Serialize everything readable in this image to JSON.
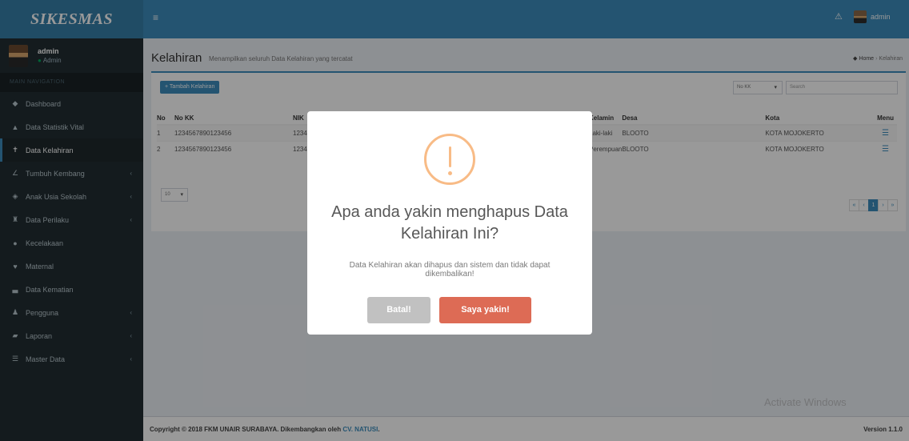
{
  "app": {
    "brand": "SIKESMAS",
    "menu_icon": "bars-icon",
    "bell_icon": "bell-icon",
    "username": "admin"
  },
  "sidebar": {
    "user_name": "admin",
    "user_status": "Admin",
    "header": "MAIN NAVIGATION",
    "items": [
      {
        "label": "Dashboard",
        "icon": "dashboard-icon",
        "glyph": "◆"
      },
      {
        "label": "Data Statistik Vital",
        "icon": "user-icon",
        "glyph": "▲"
      },
      {
        "label": "Data Kelahiran",
        "icon": "child-icon",
        "glyph": "✝"
      },
      {
        "label": "Tumbuh Kembang",
        "icon": "line-chart-icon",
        "glyph": "∠"
      },
      {
        "label": "Anak Usia Sekolah",
        "icon": "graduation-cap-icon",
        "glyph": "◈"
      },
      {
        "label": "Data Perilaku",
        "icon": "binoculars-icon",
        "glyph": "♜"
      },
      {
        "label": "Kecelakaan",
        "icon": "exclamation-circle-icon",
        "glyph": "●"
      },
      {
        "label": "Maternal",
        "icon": "heart-icon",
        "glyph": "♥"
      },
      {
        "label": "Data Kematian",
        "icon": "bed-icon",
        "glyph": "▃"
      },
      {
        "label": "Pengguna",
        "icon": "users-icon",
        "glyph": "♟"
      },
      {
        "label": "Laporan",
        "icon": "book-icon",
        "glyph": "▰"
      },
      {
        "label": "Master Data",
        "icon": "list-icon",
        "glyph": "☰"
      }
    ]
  },
  "header": {
    "title": "Kelahiran",
    "subtitle": "Menampilkan seluruh Data Kelahiran yang tercatat",
    "crumb_home": "Home",
    "crumb_current": "Kelahiran"
  },
  "toolbar": {
    "add_label": "Tambah Kelahiran",
    "filter_value": "No KK",
    "search_placeholder": "Search",
    "length_value": "10"
  },
  "table": {
    "columns": [
      "No",
      "No KK",
      "NIK",
      "Kelamin",
      "Desa",
      "Kota",
      "Menu"
    ],
    "rows": [
      {
        "no": "1",
        "kk": "1234567890123456",
        "nik": "1234567",
        "kelamin": "Laki-laki",
        "desa": "BLOOTO",
        "kota": "KOTA MOJOKERTO"
      },
      {
        "no": "2",
        "kk": "1234567890123456",
        "nik": "1234567",
        "kelamin": "Perempuan",
        "desa": "BLOOTO",
        "kota": "KOTA MOJOKERTO"
      }
    ]
  },
  "pager": {
    "first": "«",
    "prev": "‹",
    "page": "1",
    "next": "›",
    "last": "»"
  },
  "footer": {
    "copyright": "Copyright © 2018 FKM UNAIR SURABAYA. Dikembangkan oleh",
    "dev": "CV. NATUSI",
    "version": "Version 1.1.0"
  },
  "watermark": "Activate Windows",
  "modal": {
    "icon": "warning-icon",
    "title": "Apa anda yakin menghapus Data Kelahiran Ini?",
    "text": "Data Kelahiran akan dihapus dan sistem dan tidak dapat dikembalikan!",
    "cancel_label": "Batal!",
    "confirm_label": "Saya yakin!",
    "cancel_color": "#c1c1c1",
    "confirm_color": "#dd6b55"
  }
}
